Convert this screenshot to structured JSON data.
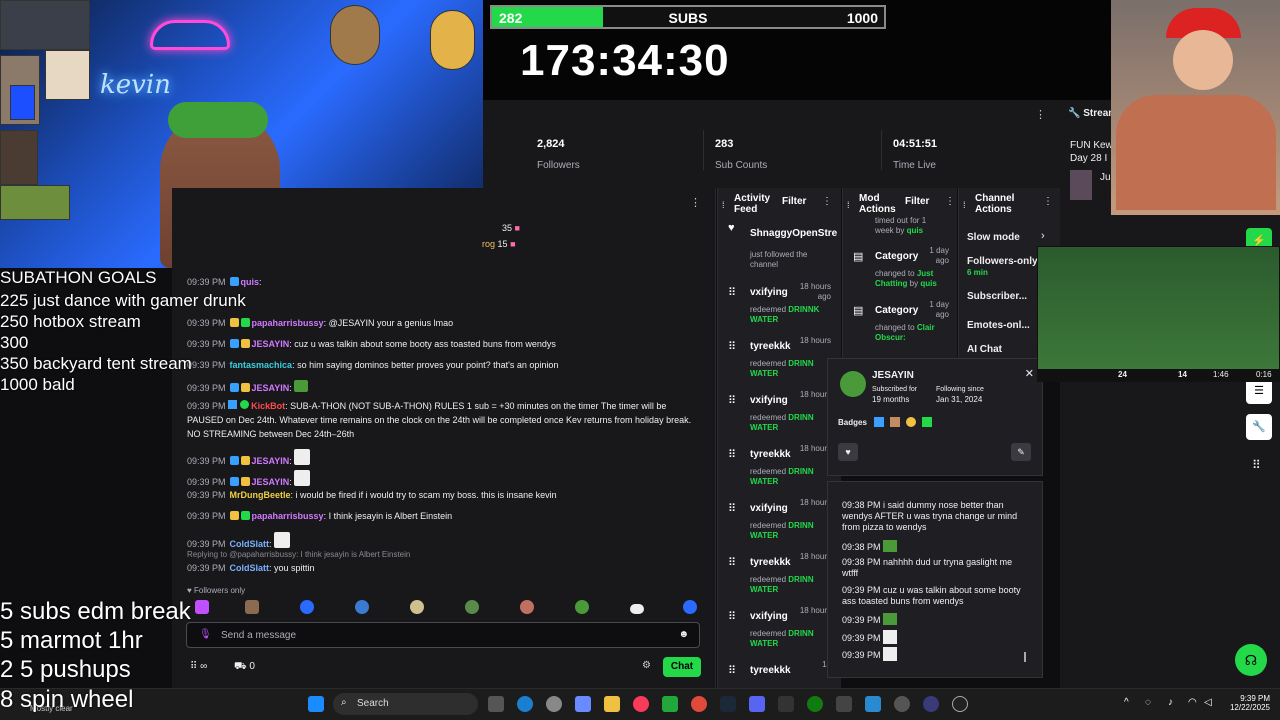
{
  "subs_goal": {
    "current": "282",
    "label": "SUBS",
    "target": "1000",
    "progress": 0.282
  },
  "timer": "173:34:30",
  "stats": [
    {
      "value": "2,824",
      "label": "Followers"
    },
    {
      "value": "283",
      "label": "Sub Counts"
    },
    {
      "value": "04:51:51",
      "label": "Time Live"
    }
  ],
  "stream_panel": {
    "title": "Stream",
    "line1": "FUN Kew",
    "line2": "Day 28 I",
    "tag": "Ju"
  },
  "overlay_goals": {
    "header": "SUBATHON GOALS",
    "items": [
      "225 just dance with gamer drunk",
      "250 hotbox stream",
      "300",
      "350 backyard tent stream",
      "1000 bald"
    ]
  },
  "overlay_rewards": [
    "5 subs edm break",
    "5 marmot 1hr",
    "2  5 pushups",
    "8 spin wheel"
  ],
  "chat": {
    "top_counts": [
      {
        "user": "",
        "count": "35"
      },
      {
        "user": "rog",
        "count": "15"
      }
    ],
    "messages": [
      {
        "time": "09:39 PM",
        "user": "quis",
        "text": ":"
      },
      {
        "time": "09:39 PM",
        "user": "papaharrisbussy",
        "text": ": @JESAYIN your a genius lmao"
      },
      {
        "time": "09:39 PM",
        "user": "JESAYIN",
        "text": ": cuz u was talkin about some booty ass toasted buns from wendys"
      },
      {
        "time": "09:39 PM",
        "user": "fantasmachica",
        "text": ": so him saying dominos better proves your point? that's an opinion"
      },
      {
        "time": "09:39 PM",
        "user": "JESAYIN",
        "text": ":"
      },
      {
        "time": "09:39 PM",
        "user": "KickBot",
        "text": ": SUB-A-THON (NOT SUB-A-THON) RULES  1 sub = +30 minutes on the timer  The timer will be PAUSED on Dec 24th.  Whatever time remains on the clock on the 24th will be completed once Kev returns from holiday break.  NO STREAMING between Dec 24th–26th"
      },
      {
        "time": "09:39 PM",
        "user": "JESAYIN",
        "text": ":"
      },
      {
        "time": "09:39 PM",
        "user": "JESAYIN",
        "text": ":"
      },
      {
        "time": "09:39 PM",
        "user": "MrDungBeetle",
        "text": ": i would be fired if i would try to scam my boss. this is insane kevin"
      },
      {
        "time": "09:39 PM",
        "user": "papaharrisbussy",
        "text": ": I think jesayin is Albert Einstein"
      },
      {
        "time": "09:39 PM",
        "user": "ColdSlatt",
        "text": ":"
      }
    ],
    "reply_context": "Replying to @papaharrisbussy: I think jesayin is Albert Einstein",
    "reply": {
      "time": "09:39 PM",
      "user": "ColdSlatt",
      "text": ": you spittin"
    },
    "followers_only": "Followers only",
    "input_placeholder": "Send a message",
    "chat_button": "Chat",
    "points": "∞",
    "gift_count": "0"
  },
  "activity_feed": {
    "title": [
      "Activity",
      "Feed"
    ],
    "filter": "Filter",
    "items": [
      {
        "user": "ShnaggyOpenStre",
        "action": "just followed the channel",
        "reward": "",
        "time": ""
      },
      {
        "user": "vxifying",
        "action": "redeemed",
        "reward": "DRINNK WATER",
        "time": "18 hours ago"
      },
      {
        "user": "tyreekkk",
        "action": "redeemed",
        "reward": "DRINN WATER",
        "time": "18 hours"
      },
      {
        "user": "vxifying",
        "action": "redeemed",
        "reward": "DRINN WATER",
        "time": "18 hours"
      },
      {
        "user": "tyreekkk",
        "action": "redeemed",
        "reward": "DRINN WATER",
        "time": "18 hours"
      },
      {
        "user": "vxifying",
        "action": "redeemed",
        "reward": "DRINN WATER",
        "time": "18 hours"
      },
      {
        "user": "tyreekkk",
        "action": "redeemed",
        "reward": "DRINN WATER",
        "time": "18 hours"
      },
      {
        "user": "vxifying",
        "action": "redeemed",
        "reward": "DRINN WATER",
        "time": "18 hours"
      },
      {
        "user": "tyreekkk",
        "action": "",
        "reward": "",
        "time": "18"
      }
    ]
  },
  "mod_actions": {
    "title": [
      "Mod",
      "Actions"
    ],
    "filter": "Filter",
    "items": [
      {
        "label": "",
        "line1": "timed out for 1",
        "line2": "week by",
        "by": "quis",
        "time": ""
      },
      {
        "label": "Category",
        "line1": "changed to",
        "value": "Just Chatting",
        "by": "quis",
        "time": "1 day ago"
      },
      {
        "label": "Category",
        "line1": "changed to",
        "value": "Clair Obscur:",
        "by": "",
        "time": "1 day ago"
      }
    ]
  },
  "channel_actions": {
    "title": [
      "Channel",
      "Actions"
    ],
    "items": [
      {
        "label": "Slow mode",
        "sub": ""
      },
      {
        "label": "Followers-only",
        "sub": "6 min"
      },
      {
        "label": "Subscriber...",
        "sub": ""
      },
      {
        "label": "Emotes-onl...",
        "sub": ""
      },
      {
        "label": "AI Chat",
        "sub": ""
      }
    ]
  },
  "user_card": {
    "username": "JESAYIN",
    "subscribed_label": "Subscribed for",
    "subscribed_value": "19 months",
    "following_label": "Following since",
    "following_value": "Jan 31, 2024",
    "badges_label": "Badges"
  },
  "user_log": [
    {
      "time": "09:38 PM",
      "text": "i said dummy nose better than wendys AFTER u was tryna change ur mind from pizza to wendys"
    },
    {
      "time": "09:38 PM",
      "text": ""
    },
    {
      "time": "09:38 PM",
      "text": "nahhhh dud ur tryna gaslight me wtfff"
    },
    {
      "time": "09:39 PM",
      "text": "cuz u was talkin about some booty ass toasted buns from wendys"
    },
    {
      "time": "09:39 PM",
      "text": ""
    },
    {
      "time": "09:39 PM",
      "text": ""
    },
    {
      "time": "09:39 PM",
      "text": ""
    }
  ],
  "football": {
    "team1": "24",
    "team2": "14",
    "clock": "1:46",
    "extra": "0:16"
  },
  "taskbar": {
    "search": "Search",
    "time": "9:39 PM",
    "date": "12/22/2025",
    "start_label": "Mostly clear"
  },
  "colors": {
    "accent": "#23d94a",
    "bg": "#0e0e10",
    "panel": "#18181b",
    "dock": "#1f1f23"
  }
}
